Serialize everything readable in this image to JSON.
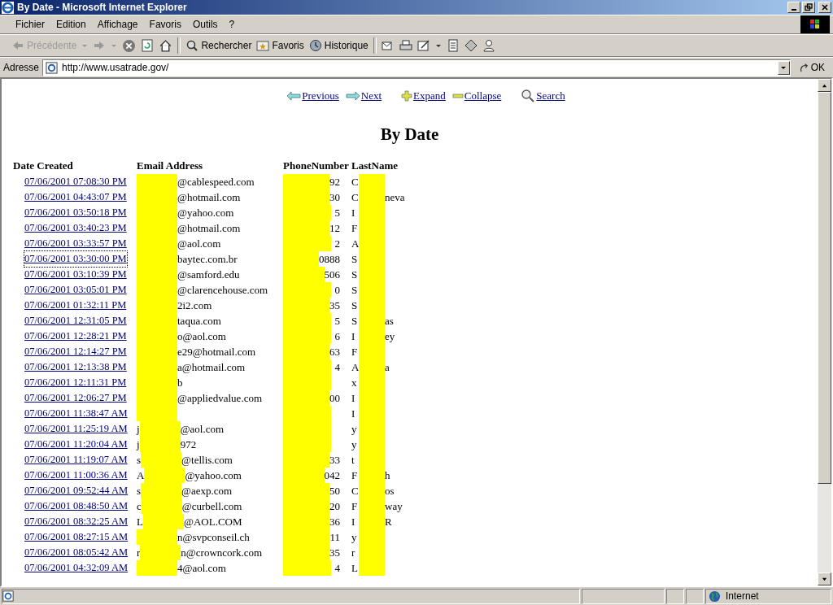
{
  "window": {
    "title": "By Date - Microsoft Internet Explorer"
  },
  "menu": [
    "Fichier",
    "Edition",
    "Affichage",
    "Favoris",
    "Outils",
    "?"
  ],
  "toolbar": {
    "back": "Précédente",
    "search": "Rechercher",
    "favorites": "Favoris",
    "history": "Historique"
  },
  "address": {
    "label": "Adresse",
    "value": "http://www.usatrade.gov/",
    "go": "OK"
  },
  "nav": [
    {
      "kind": "previous",
      "label": "Previous"
    },
    {
      "kind": "next",
      "label": "Next"
    },
    {
      "kind": "expand",
      "label": "Expand"
    },
    {
      "kind": "collapse",
      "label": "Collapse"
    },
    {
      "kind": "search",
      "label": "Search"
    }
  ],
  "heading": "By Date",
  "table": {
    "columns": [
      "Date Created",
      "Email Address",
      "PhoneNumber",
      "LastName"
    ],
    "rows": [
      {
        "date": "07/06/2001 07:08:30 PM",
        "focused": false,
        "email_end": "@cablespeed.com",
        "phone_end": "92",
        "last_start": "C"
      },
      {
        "date": "07/06/2001 04:43:07 PM",
        "focused": false,
        "email_end": "@hotmail.com",
        "phone_end": "30",
        "last_start": "C",
        "last_end": "neva"
      },
      {
        "date": "07/06/2001 03:50:18 PM",
        "focused": false,
        "email_end": "@yahoo.com",
        "phone_end": "5",
        "last_start": "I"
      },
      {
        "date": "07/06/2001 03:40:23 PM",
        "focused": false,
        "email_end": "@hotmail.com",
        "phone_end": "12",
        "last_start": "F"
      },
      {
        "date": "07/06/2001 03:33:57 PM",
        "focused": false,
        "email_end": "@aol.com",
        "phone_end": "2",
        "last_start": "A"
      },
      {
        "date": "07/06/2001 03:30:00 PM",
        "focused": true,
        "email_end": "baytec.com.br",
        "phone_end": "0888",
        "last_start": "S"
      },
      {
        "date": "07/06/2001 03:10:39 PM",
        "focused": false,
        "email_end": "@samford.edu",
        "phone_end": "506",
        "last_start": "S"
      },
      {
        "date": "07/06/2001 03:05:01 PM",
        "focused": false,
        "email_end": "@clarencehouse.com",
        "phone_end": "0",
        "last_start": "S"
      },
      {
        "date": "07/06/2001 01:32:11 PM",
        "focused": false,
        "email_end": "2i2.com",
        "phone_end": "35",
        "last_start": "S"
      },
      {
        "date": "07/06/2001 12:31:05 PM",
        "focused": false,
        "email_end": "taqua.com",
        "phone_end": "5",
        "last_start": "S",
        "last_end": "as"
      },
      {
        "date": "07/06/2001 12:28:21 PM",
        "focused": false,
        "email_end": "o@aol.com",
        "phone_end": "6",
        "last_start": "I",
        "last_end": "ey"
      },
      {
        "date": "07/06/2001 12:14:27 PM",
        "focused": false,
        "email_end": "e29@hotmail.com",
        "phone_end": "63",
        "last_start": "F"
      },
      {
        "date": "07/06/2001 12:13:38 PM",
        "focused": false,
        "email_end": "a@hotmail.com",
        "phone_end": "4",
        "last_start": "A",
        "last_end": "a"
      },
      {
        "date": "07/06/2001 12:11:31 PM",
        "focused": false,
        "email_end": "b",
        "last_start": "x"
      },
      {
        "date": "07/06/2001 12:06:27 PM",
        "focused": false,
        "email_end": "@appliedvalue.com",
        "phone_end": "00",
        "last_start": "I"
      },
      {
        "date": "07/06/2001 11:38:47 AM",
        "focused": false,
        "last_start": "I"
      },
      {
        "date": "07/06/2001 11:25:19 AM",
        "focused": false,
        "email_start": "j",
        "email_end": "@aol.com",
        "last_start": "y"
      },
      {
        "date": "07/06/2001 11:20:04 AM",
        "focused": false,
        "email_start": "j",
        "email_end": "972",
        "last_start": "y"
      },
      {
        "date": "07/06/2001 11:19:07 AM",
        "focused": false,
        "email_start": "s",
        "email_end": "@tellis.com",
        "phone_end": "33",
        "last_start": "t"
      },
      {
        "date": "07/06/2001 11:00:36 AM",
        "focused": false,
        "email_start": "A",
        "email_end": "@yahoo.com",
        "phone_end": "042",
        "last_start": "F",
        "last_end": "h"
      },
      {
        "date": "07/06/2001 09:52:44 AM",
        "focused": false,
        "email_start": "s",
        "email_end": "@aexp.com",
        "phone_end": "50",
        "last_start": "C",
        "last_end": "os"
      },
      {
        "date": "07/06/2001 08:48:50 AM",
        "focused": false,
        "email_start": "c",
        "email_end": "@curbell.com",
        "phone_end": "20",
        "last_start": "F",
        "last_end": "way"
      },
      {
        "date": "07/06/2001 08:32:25 AM",
        "focused": false,
        "email_start": "L",
        "email_end": "@AOL.COM",
        "phone_end": "36",
        "last_start": "I",
        "last_end": "R"
      },
      {
        "date": "07/06/2001 08:27:15 AM",
        "focused": false,
        "email_end": "n@svpconseil.ch",
        "phone_end": "11",
        "last_start": "y"
      },
      {
        "date": "07/06/2001 08:05:42 AM",
        "focused": false,
        "email_start": "r",
        "email_end": "n@crowncork.com",
        "phone_end": "35",
        "last_start": "r"
      },
      {
        "date": "07/06/2001 04:32:09 AM",
        "focused": false,
        "email_end": "4@aol.com",
        "phone_end": "4",
        "last_start": "L"
      }
    ]
  },
  "status_bar": {
    "zone": "Internet"
  }
}
